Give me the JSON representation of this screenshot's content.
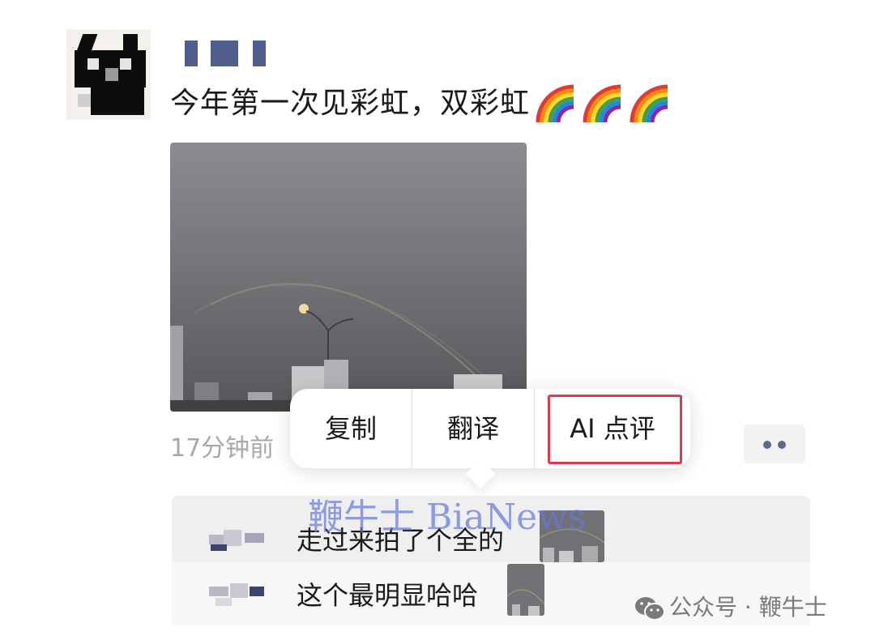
{
  "post": {
    "text": "今年第一次见彩虹，双彩虹",
    "emojis": [
      "rainbow",
      "rainbow",
      "rainbow"
    ],
    "time": "17分钟前"
  },
  "popup_menu": {
    "items": [
      {
        "label": "复制"
      },
      {
        "label": "翻译"
      },
      {
        "label": "AI 点评"
      }
    ],
    "highlight_color": "#e03a48"
  },
  "comments": [
    {
      "text": "走过来拍了个全的"
    },
    {
      "text": "这个最明显哈哈"
    }
  ],
  "watermark": "鞭牛士 BiaNews",
  "footer": {
    "text": "公众号 · 鞭牛士"
  },
  "colors": {
    "link_name": "#4f5e8c",
    "muted_text": "#a8a8a8"
  }
}
